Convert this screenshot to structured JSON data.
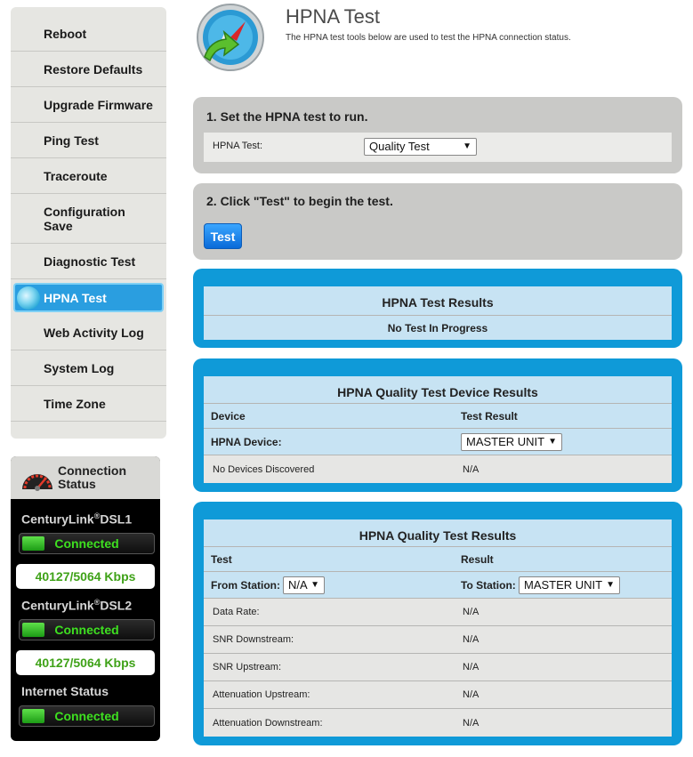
{
  "sidebar": {
    "items": [
      {
        "label": "Reboot"
      },
      {
        "label": "Restore Defaults"
      },
      {
        "label": "Upgrade Firmware"
      },
      {
        "label": "Ping Test"
      },
      {
        "label": "Traceroute"
      },
      {
        "label": "Configuration Save"
      },
      {
        "label": "Diagnostic Test"
      },
      {
        "label": "HPNA Test"
      },
      {
        "label": "Web Activity Log"
      },
      {
        "label": "System Log"
      },
      {
        "label": "Time Zone"
      }
    ],
    "active_index": 7
  },
  "connection": {
    "title": "Connection Status",
    "dsl1": {
      "brand": "CenturyLink",
      "reg": "®",
      "suffix": "DSL1",
      "status": "Connected",
      "speed": "40127/5064 Kbps"
    },
    "dsl2": {
      "brand": "CenturyLink",
      "reg": "®",
      "suffix": "DSL2",
      "status": "Connected",
      "speed": "40127/5064 Kbps"
    },
    "internet": {
      "label": "Internet Status",
      "status": "Connected"
    }
  },
  "header": {
    "title": "HPNA Test",
    "description": "The HPNA test tools below are used to test the HPNA connection status."
  },
  "step1": {
    "heading": "1. Set the HPNA test to run.",
    "field_label": "HPNA Test:",
    "selected": "Quality Test"
  },
  "step2": {
    "heading": "2. Click \"Test\" to begin the test.",
    "button": "Test"
  },
  "results": {
    "title": "HPNA Test Results",
    "status": "No Test In Progress"
  },
  "device_results": {
    "title": "HPNA Quality Test Device Results",
    "col1": "Device",
    "col2": "Test Result",
    "device_label": "HPNA Device:",
    "device_selected": "MASTER UNIT",
    "row_left": "No Devices Discovered",
    "row_right": "N/A"
  },
  "quality_results": {
    "title": "HPNA Quality Test Results",
    "col1": "Test",
    "col2": "Result",
    "from_label": "From Station:",
    "from_selected": "N/A",
    "to_label": "To Station:",
    "to_selected": "MASTER UNIT",
    "rows": [
      {
        "name": "Data Rate:",
        "value": "N/A"
      },
      {
        "name": "SNR Downstream:",
        "value": "N/A"
      },
      {
        "name": "SNR Upstream:",
        "value": "N/A"
      },
      {
        "name": "Attenuation Upstream:",
        "value": "N/A"
      },
      {
        "name": "Attenuation Downstream:",
        "value": "N/A"
      }
    ]
  },
  "colors": {
    "accent_blue": "#0f9ad8",
    "connected_green": "#3ee020",
    "panel_gray": "#c9c9c7"
  }
}
